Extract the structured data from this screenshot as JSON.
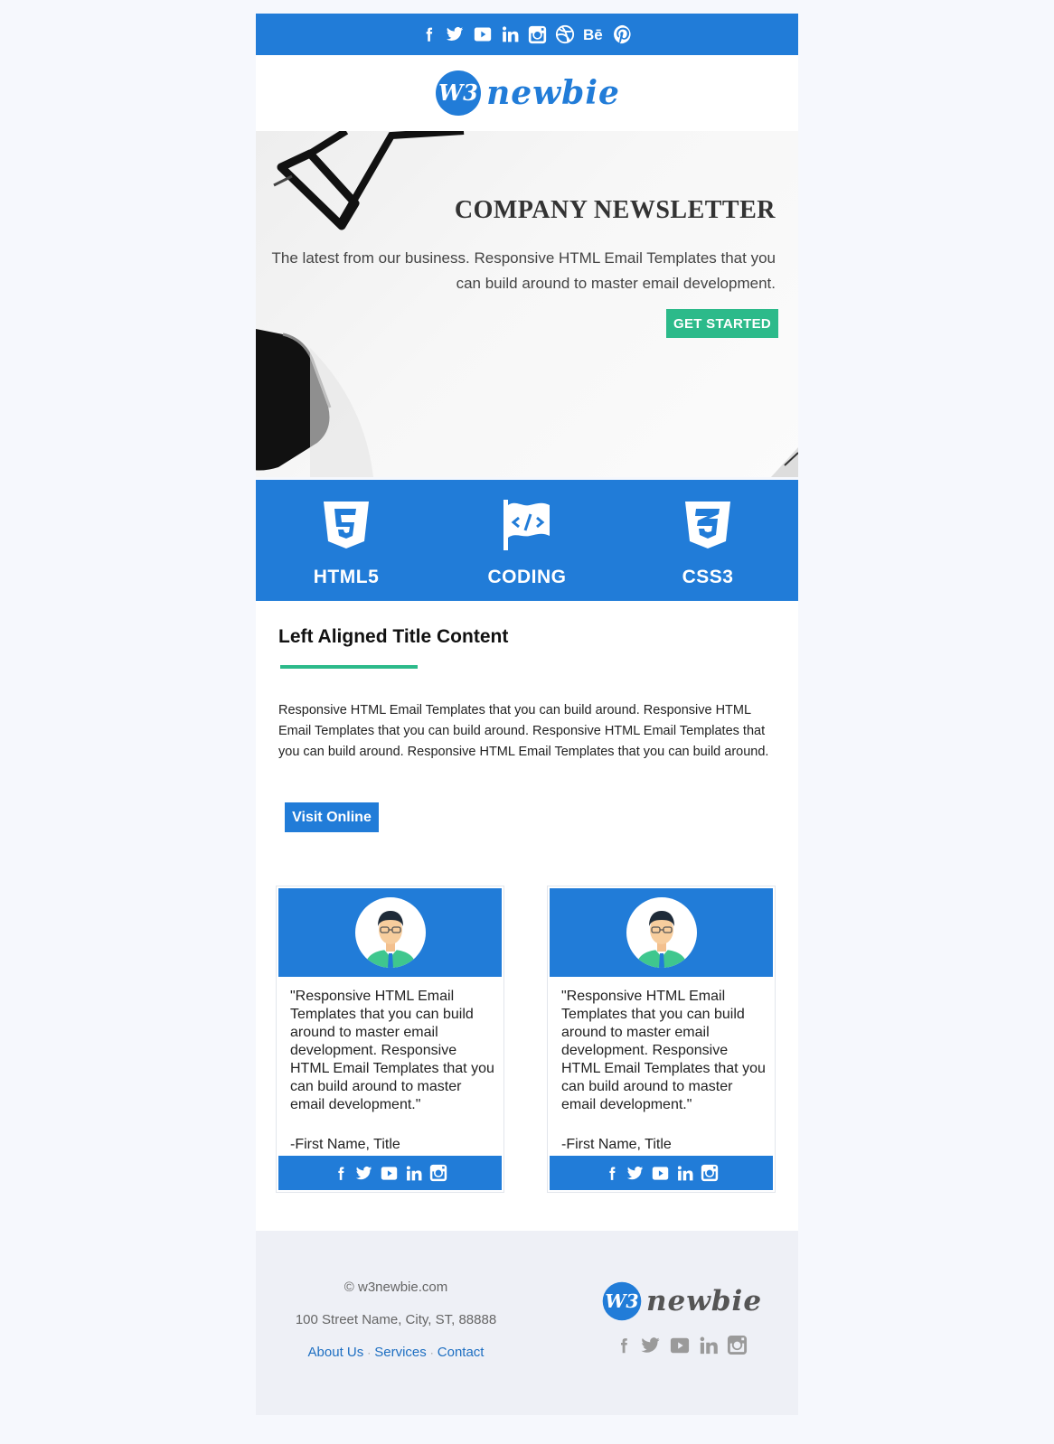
{
  "colors": {
    "primary": "#217cd8",
    "accent": "#2cba8a",
    "footer_bg": "#eef0f6"
  },
  "top_social": [
    "facebook-icon",
    "twitter-icon",
    "youtube-icon",
    "linkedin-icon",
    "instagram-icon",
    "dribbble-icon",
    "behance-icon",
    "pinterest-icon"
  ],
  "logo": {
    "mark": "W3",
    "text": "newbie"
  },
  "hero": {
    "title": "COMPANY NEWSLETTER",
    "text": "The latest from our business. Responsive HTML Email Templates that you can build around to master email development.",
    "button": "GET STARTED"
  },
  "features": [
    {
      "icon": "html5-icon",
      "label": "HTML5"
    },
    {
      "icon": "code-flag-icon",
      "label": "CODING"
    },
    {
      "icon": "css3-icon",
      "label": "CSS3"
    }
  ],
  "content": {
    "title": "Left Aligned Title Content",
    "text": "Responsive HTML Email Templates that you can build around. Responsive HTML Email Templates that you can build around. Responsive HTML Email Templates that you can build around. Responsive HTML Email Templates that you can build around.",
    "button": "Visit Online"
  },
  "testimonials": [
    {
      "quote": "\"Responsive HTML Email Templates that you can build around to master email development. Responsive HTML Email Templates that you can build around to master email development.\"",
      "author": "-First Name, Title"
    },
    {
      "quote": "\"Responsive HTML Email Templates that you can build around to master email development. Responsive HTML Email Templates that you can build around to master email development.\"",
      "author": "-First Name, Title"
    }
  ],
  "footer": {
    "copyright": "© w3newbie.com",
    "address": "100 Street Name, City, ST, 88888",
    "links": [
      "About Us",
      "Services",
      "Contact"
    ],
    "separator": "·"
  }
}
